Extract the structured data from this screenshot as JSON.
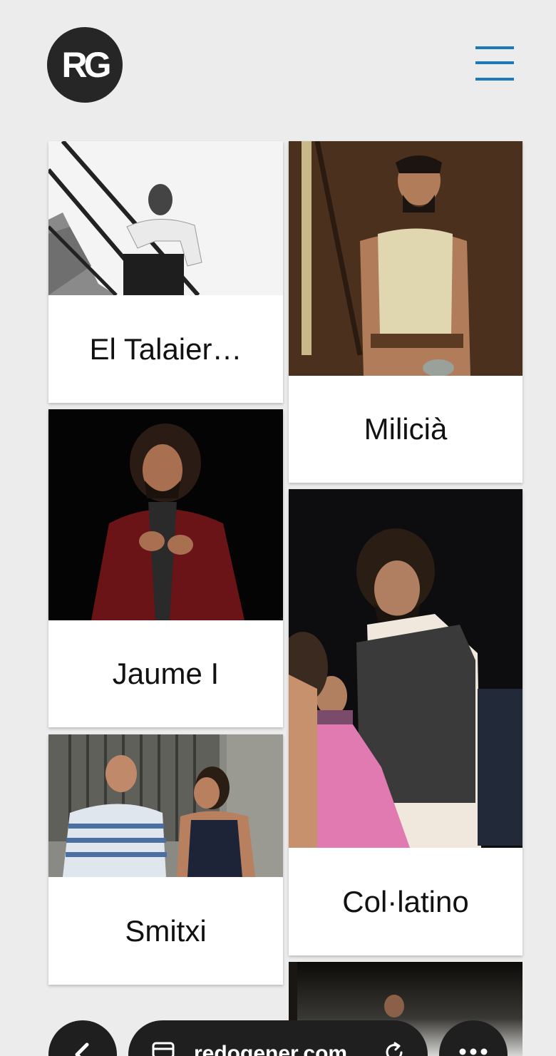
{
  "header": {
    "logo_text": "RG",
    "menu_icon": "hamburger-menu-icon",
    "accent_color": "#1d7ab8"
  },
  "cards": [
    {
      "title": "El Talaier…"
    },
    {
      "title": "Milicià"
    },
    {
      "title": "Jaume I"
    },
    {
      "title": "Col·latino"
    },
    {
      "title": "Smitxi"
    },
    {
      "title": ""
    }
  ],
  "browser": {
    "url": "redogener.com",
    "back_icon": "chevron-left-icon",
    "tab_icon": "tab-icon",
    "reload_icon": "reload-icon",
    "more_icon": "more-dots-icon"
  }
}
